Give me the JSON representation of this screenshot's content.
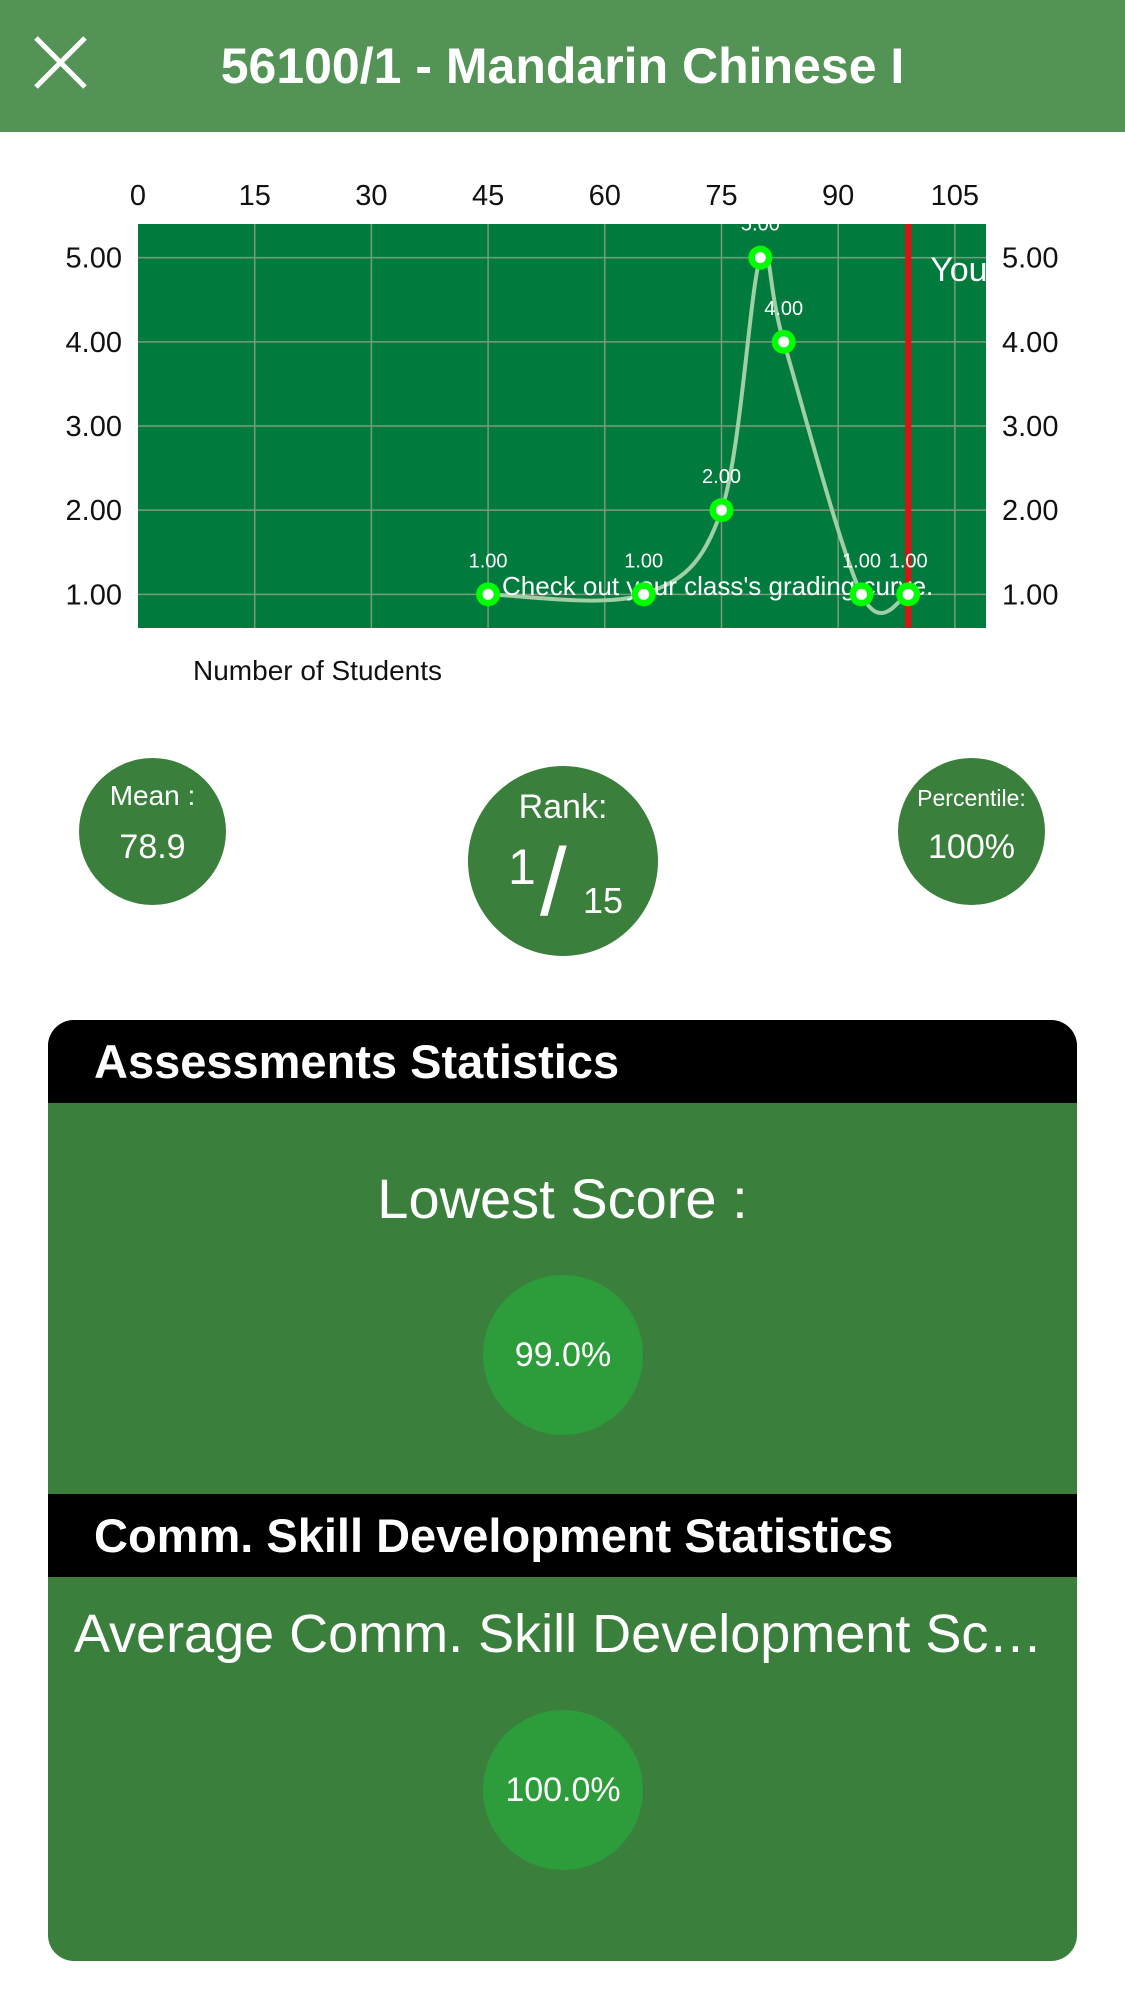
{
  "header": {
    "title": "56100/1 - Mandarin Chinese I",
    "close_icon": "close-icon",
    "background": "#549356"
  },
  "chart_data": {
    "type": "line",
    "x_ticks": [
      "0",
      "15",
      "30",
      "45",
      "60",
      "75",
      "90",
      "105"
    ],
    "y_ticks": [
      "5.00",
      "4.00",
      "3.00",
      "2.00",
      "1.00"
    ],
    "xlim": [
      0,
      109
    ],
    "ylim": [
      0.6,
      5.4
    ],
    "points": [
      {
        "x": 45,
        "y": 1,
        "label": "1.00"
      },
      {
        "x": 65,
        "y": 1,
        "label": "1.00"
      },
      {
        "x": 75,
        "y": 2,
        "label": "2.00"
      },
      {
        "x": 80,
        "y": 5,
        "label": "5.00"
      },
      {
        "x": 83,
        "y": 4,
        "label": "4.00"
      },
      {
        "x": 93,
        "y": 1,
        "label": "1.00"
      },
      {
        "x": 99,
        "y": 1,
        "label": "1.00"
      }
    ],
    "you_marker": {
      "x": 99,
      "label": "You"
    },
    "overlay_text": "Check out your class's grading curve.",
    "xlabel": "Number of Students",
    "colors": {
      "plot_bg": "#007a3d",
      "point": "#00ff00",
      "marker_line": "#e01010",
      "curve": "#9fcfa5"
    }
  },
  "stats": {
    "mean": {
      "label": "Mean :",
      "value": "78.9"
    },
    "rank": {
      "label": "Rank:",
      "position": "1",
      "slash": "/",
      "total": "15"
    },
    "percentile": {
      "label": "Percentile:",
      "value": "100%"
    }
  },
  "sections": [
    {
      "title": "Assessments Statistics",
      "label": "Lowest Score :",
      "value": "99.0%"
    },
    {
      "title": "Comm. Skill Development Statistics",
      "label": "Average Comm. Skill Development Score :",
      "value": "100.0%"
    }
  ]
}
